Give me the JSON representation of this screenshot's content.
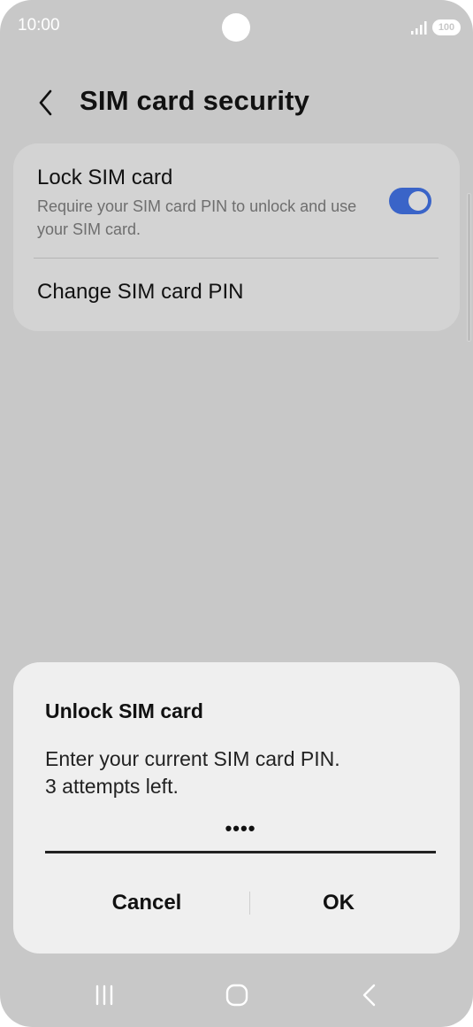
{
  "status_bar": {
    "time": "10:00",
    "battery": "100"
  },
  "header": {
    "title": "SIM card security"
  },
  "settings": {
    "lock_sim": {
      "title": "Lock SIM card",
      "description": "Require your SIM card PIN to unlock and use your SIM card.",
      "enabled": true
    },
    "change_pin": {
      "label": "Change SIM card PIN"
    }
  },
  "dialog": {
    "title": "Unlock SIM card",
    "message_line1": "Enter your current SIM card PIN.",
    "message_line2": "3 attempts left.",
    "pin_value": "••••",
    "cancel_label": "Cancel",
    "ok_label": "OK"
  },
  "nav": {
    "recents": "recents-icon",
    "home": "home-icon",
    "back": "back-icon"
  },
  "colors": {
    "accent": "#3a64c8",
    "background": "#c8c8c8",
    "dialog": "#efefef"
  }
}
